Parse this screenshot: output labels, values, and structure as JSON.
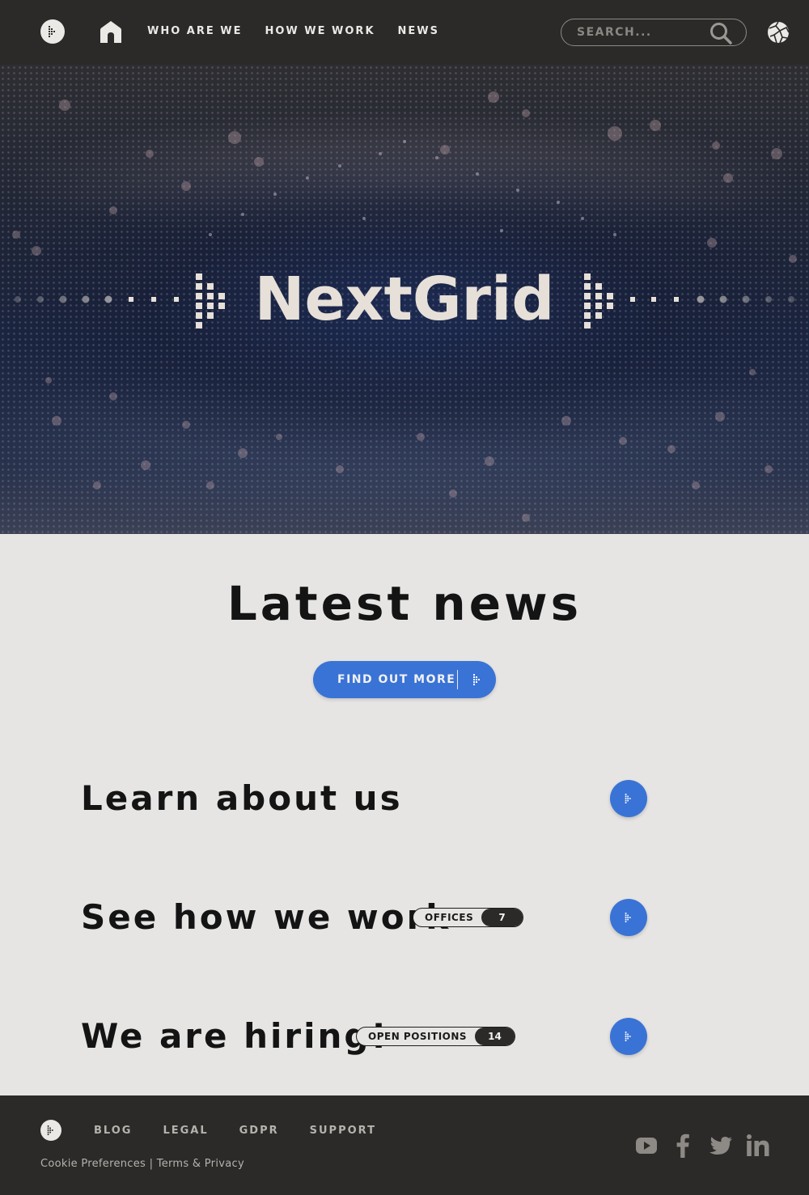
{
  "header": {
    "nav": [
      "WHO ARE WE",
      "HOW WE WORK",
      "NEWS"
    ],
    "search_placeholder": "SEARCH..."
  },
  "hero": {
    "title": "NextGrid"
  },
  "news": {
    "title": "Latest news",
    "cta_label": "FIND OUT MORE"
  },
  "rows": [
    {
      "title": "Learn about us"
    },
    {
      "title": "See how we work",
      "badge_label": "OFFICES",
      "badge_count": "7"
    },
    {
      "title": "We are hiring!",
      "badge_label": "OPEN POSITIONS",
      "badge_count": "14"
    }
  ],
  "footer": {
    "links": [
      "BLOG",
      "LEGAL",
      "GDPR",
      "SUPPORT"
    ],
    "cookie_link": "Cookie Preferences",
    "separator": "|",
    "terms_link": "Terms & Privacy"
  },
  "icons": {
    "logo": "nextgrid-logo-icon",
    "home": "home-icon",
    "search": "search-icon",
    "globe": "globe-icon",
    "arrow": "grid-arrow-icon",
    "social": [
      "youtube-icon",
      "facebook-icon",
      "twitter-icon",
      "linkedin-icon"
    ]
  },
  "colors": {
    "header_bg": "#2b2a29",
    "body_bg": "#e6e5e3",
    "accent_blue": "#3a73d6",
    "text_dark": "#141414",
    "hero_text": "#e6e0d8"
  }
}
